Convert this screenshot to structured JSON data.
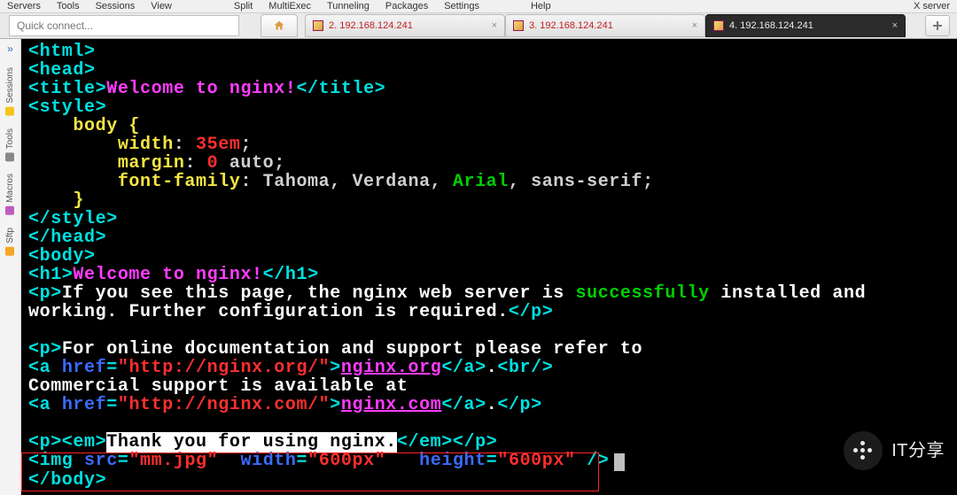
{
  "menubar": {
    "items": [
      "Servers",
      "Tools",
      "Sessions",
      "View",
      "Split",
      "MultiExec",
      "Tunneling",
      "Packages",
      "Settings",
      "Help"
    ],
    "right": "X server"
  },
  "toolbar": {
    "quick_connect_placeholder": "Quick connect..."
  },
  "tabs": [
    {
      "label": "2. 192.168.124.241",
      "active": false
    },
    {
      "label": "3. 192.168.124.241",
      "active": false
    },
    {
      "label": "4. 192.168.124.241",
      "active": true
    }
  ],
  "sidebar": {
    "items": [
      {
        "label": "Sessions"
      },
      {
        "label": "Tools"
      },
      {
        "label": "Macros"
      },
      {
        "label": "Sftp"
      }
    ]
  },
  "code": {
    "l1a": "<html>",
    "l2a": "<head>",
    "l3a": "<title>",
    "l3b": "Welcome to nginx!",
    "l3c": "</title>",
    "l4a": "<style>",
    "l5": "    body {",
    "l6a": "        width",
    "l6b": ": ",
    "l6c": "35em",
    "l6d": ";",
    "l7a": "        margin",
    "l7b": ": ",
    "l7c": "0",
    "l7d": " auto;",
    "l8a": "        font-family",
    "l8b": ": Tahoma, Verdana, ",
    "l8c": "Arial",
    "l8d": ", sans-serif;",
    "l9": "    }",
    "l10": "</style>",
    "l11": "</head>",
    "l12": "<body>",
    "l13a": "<h1>",
    "l13b": "Welcome to nginx!",
    "l13c": "</h1>",
    "l14a": "<p>",
    "l14b": "If you see this page, the nginx web server is ",
    "l14c": "successfully",
    "l14d": " installed and",
    "l15a": "working. Further configuration is required.",
    "l15b": "</p>",
    "l17a": "<p>",
    "l17b": "For online documentation and support please refer to",
    "l18a": "<a ",
    "l18b": "href",
    "l18c": "=",
    "l18d": "\"http://nginx.org/\"",
    "l18e": ">",
    "l18f": "nginx.org",
    "l18g": "</a>",
    "l18h": ".",
    "l18i": "<br/>",
    "l19": "Commercial support is available at",
    "l20a": "<a ",
    "l20b": "href",
    "l20c": "=",
    "l20d": "\"http://nginx.com/\"",
    "l20e": ">",
    "l20f": "nginx.com",
    "l20g": "</a>",
    "l20h": ".",
    "l20i": "</p>",
    "l22a": "<p><em>",
    "l22b": "Thank you for using nginx.",
    "l22c": "</em></p>",
    "l23a": "<img ",
    "l23b": "src",
    "l23c": "=",
    "l23d": "\"mm.jpg\"",
    "l23e": "  ",
    "l23f": "width",
    "l23g": "=",
    "l23h": "\"600px\"",
    "l23i": "   ",
    "l23j": "height",
    "l23k": "=",
    "l23l": "\"600px\"",
    "l23m": " />",
    "l24": "</body>"
  },
  "watermark": {
    "label": "IT分享"
  }
}
